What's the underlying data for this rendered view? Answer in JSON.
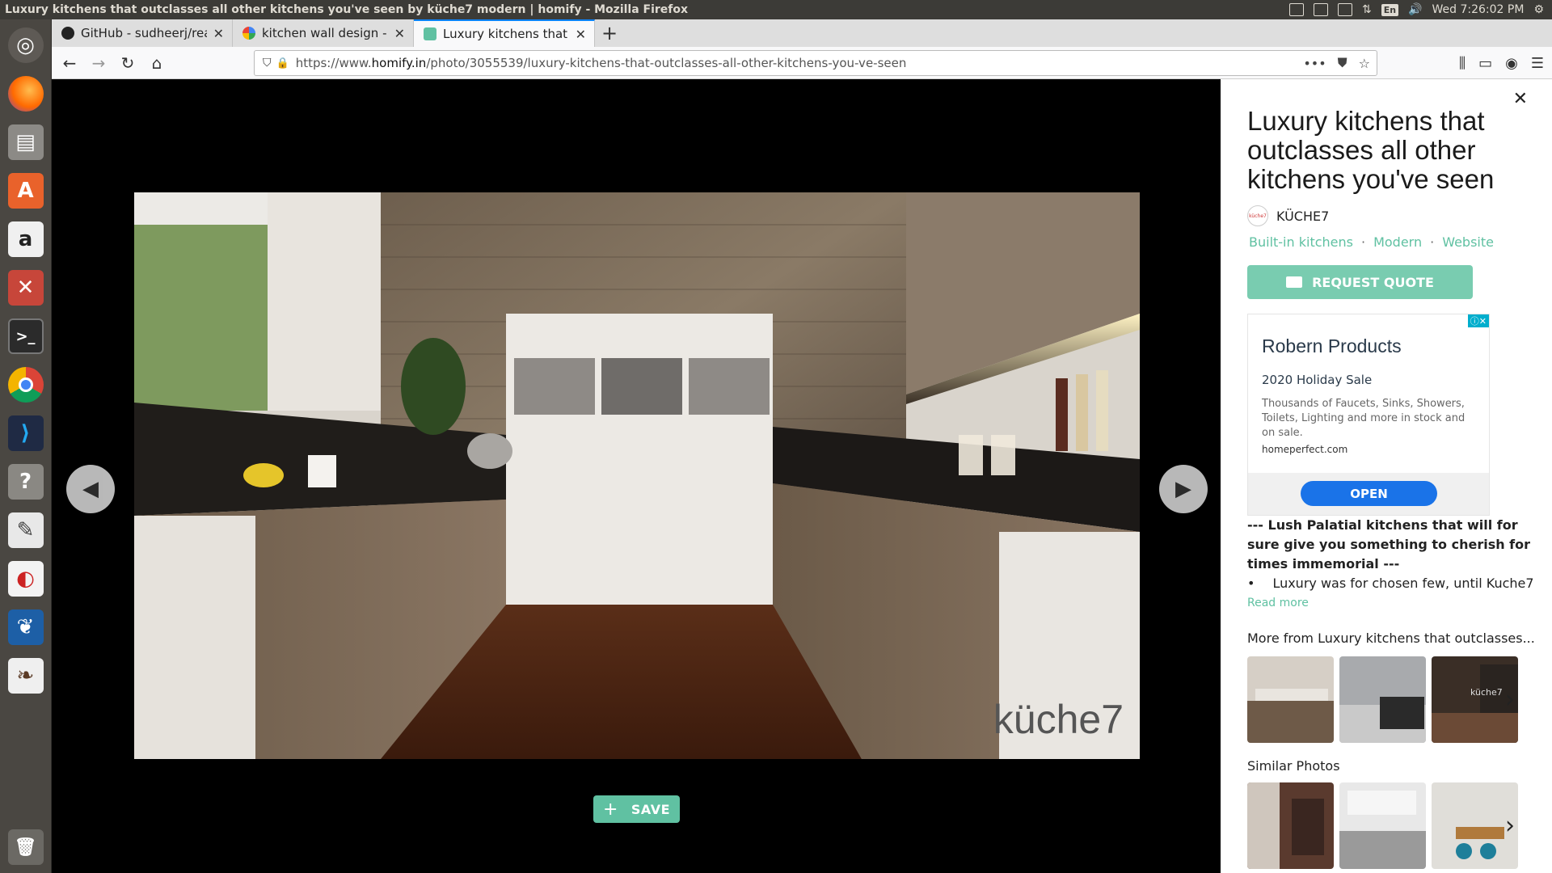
{
  "window": {
    "title": "Luxury kitchens that outclasses all other kitchens you've seen by küche7 modern | homify - Mozilla Firefox",
    "clock": "Wed 7:26:02 PM",
    "lang": "En"
  },
  "tabs": [
    {
      "label": "GitHub - sudheerj/reactj",
      "favicon": "github-icon",
      "active": false
    },
    {
      "label": "kitchen wall design - Go",
      "favicon": "google-icon",
      "active": false
    },
    {
      "label": "Luxury kitchens that out",
      "favicon": "homify-icon",
      "active": true
    }
  ],
  "nav": {
    "url_prefix": "https://www.",
    "url_domain": "homify.in",
    "url_path": "/photo/3055539/luxury-kitchens-that-outclasses-all-other-kitchens-you-ve-seen"
  },
  "viewer": {
    "watermark": "küche7",
    "save_label": "SAVE"
  },
  "panel": {
    "title": "Luxury kitchens that outclasses all other kitchens you've seen",
    "brand_name": "KÜCHE7",
    "brand_logo_text": "küche7",
    "tags": [
      "Built-in kitchens",
      "Modern",
      "Website"
    ],
    "quote_label": "REQUEST QUOTE",
    "ad": {
      "headline": "Robern Products",
      "subhead": "2020 Holiday Sale",
      "body": "Thousands of Faucets, Sinks, Showers, Toilets, Lighting and more in stock and on sale.",
      "domain": "homeperfect.com",
      "cta": "OPEN"
    },
    "desc_bold": "--- Lush Palatial kitchens that will for sure give you something to cherish for times immemorial ---",
    "desc_bullet_mark": "•",
    "desc_bullet": "Luxury was for chosen few, until Kuche7",
    "read_more": "Read more",
    "more_from_title": "More from Luxury kitchens that outclasses...",
    "similar_title": "Similar Photos",
    "more_from_thumb_text": "küche7"
  },
  "colors": {
    "accent": "#60c1a2",
    "ad_button": "#1a73e8",
    "firefox_active_tab": "#0a84ff"
  }
}
